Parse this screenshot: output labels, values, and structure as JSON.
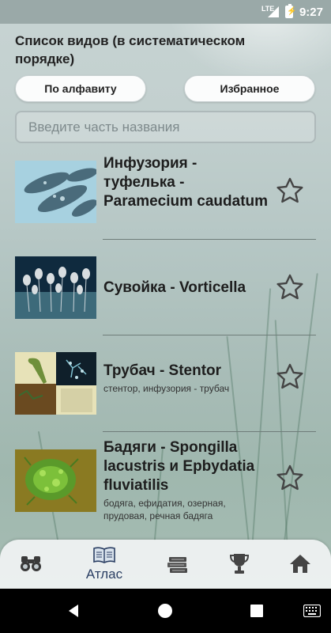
{
  "status_bar": {
    "network": "LTE",
    "battery": "⚡",
    "time": "9:27"
  },
  "page": {
    "title": "Список видов (в систематическом порядке)",
    "sort_buttons": {
      "alphabet": "По алфавиту",
      "favorites": "Избранное"
    },
    "search": {
      "placeholder": "Введите часть названия",
      "value": ""
    }
  },
  "species": [
    {
      "name": "Инфузория - туфелька - Paramecium caudatum",
      "subtitle": "",
      "favorite": false,
      "thumb_icon": "paramecium-photo"
    },
    {
      "name": "Сувойка  - Vorticella",
      "subtitle": "",
      "favorite": false,
      "thumb_icon": "vorticella-photo"
    },
    {
      "name": "Трубач  - Stentor",
      "subtitle": "стентор, инфузория - трубач",
      "favorite": false,
      "thumb_icon": "stentor-photo"
    },
    {
      "name": "Бадяги  - Spongilla lacustris и Epbydatia fluviatilis",
      "subtitle": "бодяга, ефидатия, озерная, прудовая, речная бадяга",
      "favorite": false,
      "thumb_icon": "spongilla-photo"
    }
  ],
  "bottom_nav": {
    "items": [
      {
        "icon": "binoculars-icon",
        "label": ""
      },
      {
        "icon": "book-icon",
        "label": "Атлас",
        "active": true
      },
      {
        "icon": "books-stack-icon",
        "label": ""
      },
      {
        "icon": "trophy-icon",
        "label": ""
      },
      {
        "icon": "home-icon",
        "label": ""
      }
    ]
  },
  "colors": {
    "accent": "#2b3f63",
    "status_bar": "#9aa9a8",
    "text": "#1d1d1d"
  }
}
